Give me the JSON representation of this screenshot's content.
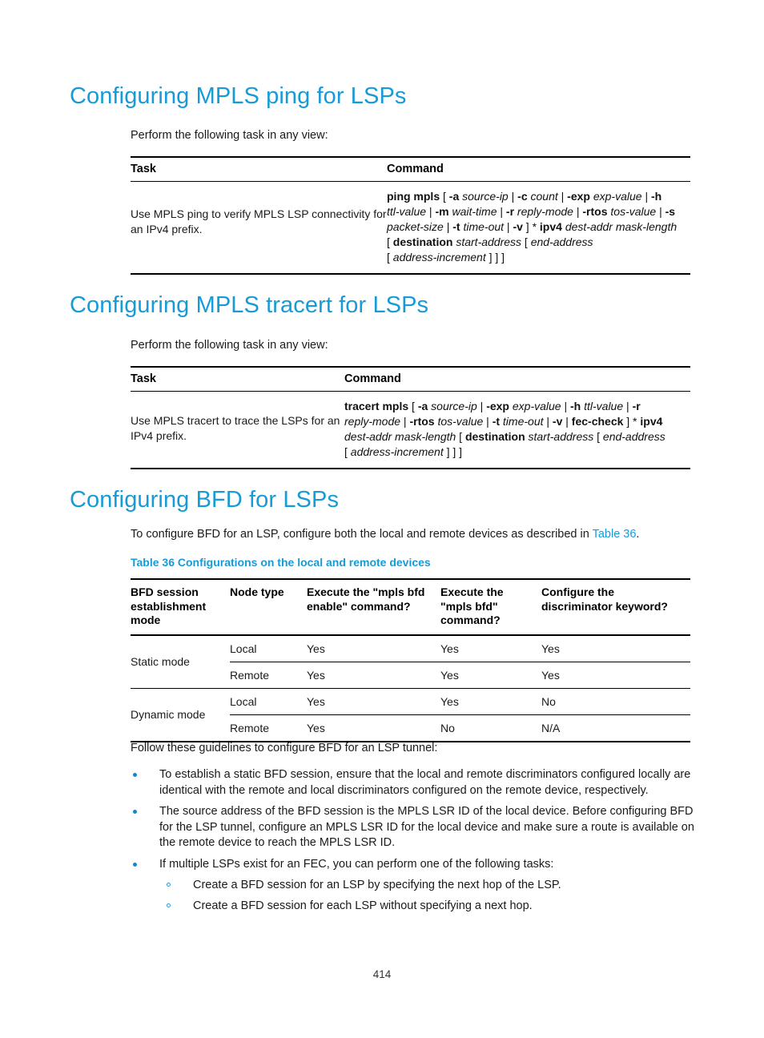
{
  "document": {
    "page_number": "414"
  },
  "sections": [
    {
      "heading": "Configuring MPLS ping for LSPs",
      "intro": "Perform the following task in any view:",
      "table": {
        "headers": {
          "task": "Task",
          "command": "Command"
        },
        "rows": [
          {
            "task": "Use MPLS ping to verify MPLS LSP connectivity for an IPv4 prefix.",
            "command_lines": [
              "ping mpls [ -a source-ip | -c count | -exp exp-value | -h",
              "ttl-value | -m wait-time | -r reply-mode | -rtos tos-value | -s",
              "packet-size | -t time-out | -v ] * ipv4 dest-addr mask-length",
              "[ destination start-address [ end-address",
              "[ address-increment ] ] ]"
            ]
          }
        ]
      }
    },
    {
      "heading": "Configuring MPLS tracert for LSPs",
      "intro": "Perform the following task in any view:",
      "table": {
        "headers": {
          "task": "Task",
          "command": "Command"
        },
        "rows": [
          {
            "task": "Use MPLS tracert to trace the LSPs for an IPv4 prefix.",
            "command_lines": [
              "tracert mpls [ -a source-ip | -exp exp-value | -h ttl-value | -r",
              "reply-mode | -rtos tos-value | -t time-out | -v | fec-check ] * ipv4",
              "dest-addr mask-length [ destination start-address [ end-address",
              "[ address-increment ] ] ]"
            ]
          }
        ]
      }
    }
  ],
  "bfd_section": {
    "heading": "Configuring BFD for LSPs",
    "intro_before_link": "To configure BFD for an LSP, configure both the local and remote devices as described in ",
    "intro_link": "Table 36",
    "intro_after_link": ".",
    "table_caption": "Table 36 Configurations on the local and remote devices",
    "table": {
      "headers": [
        "BFD session establishment mode",
        "Node type",
        "Execute the \"mpls bfd enable\" command?",
        "Execute the \"mpls bfd\" command?",
        "Configure the discriminator keyword?"
      ],
      "groups": [
        {
          "mode": "Static mode",
          "rows": [
            {
              "node_type": "Local",
              "bfd_enable": "Yes",
              "mpls_bfd": "Yes",
              "discriminator": "Yes"
            },
            {
              "node_type": "Remote",
              "bfd_enable": "Yes",
              "mpls_bfd": "Yes",
              "discriminator": "Yes"
            }
          ]
        },
        {
          "mode": "Dynamic mode",
          "rows": [
            {
              "node_type": "Local",
              "bfd_enable": "Yes",
              "mpls_bfd": "Yes",
              "discriminator": "No"
            },
            {
              "node_type": "Remote",
              "bfd_enable": "Yes",
              "mpls_bfd": "No",
              "discriminator": "N/A"
            }
          ]
        }
      ]
    },
    "guidelines_intro": "Follow these guidelines to configure BFD for an LSP tunnel:",
    "guidelines": [
      "To establish a static BFD session,  ensure that the local and remote discriminators configured locally are identical with the remote and local discriminators configured on the remote device, respectively.",
      "The source address of the BFD session is the MPLS LSR ID of the local device. Before configuring BFD for the LSP tunnel, configure an MPLS LSR ID for the local device and make sure a route is available on the remote device to reach the MPLS LSR ID.",
      "If multiple LSPs exist for an FEC, you can perform one of the following tasks:"
    ],
    "sub_guidelines": [
      "Create a BFD session for an LSP by specifying the next hop of the LSP.",
      "Create a BFD session for each LSP without specifying a next hop."
    ]
  },
  "colors": {
    "heading": "#179BD7",
    "link": "#179BD7",
    "bullet": "#1289C6",
    "sub_bullet": "#2E9BD6"
  }
}
